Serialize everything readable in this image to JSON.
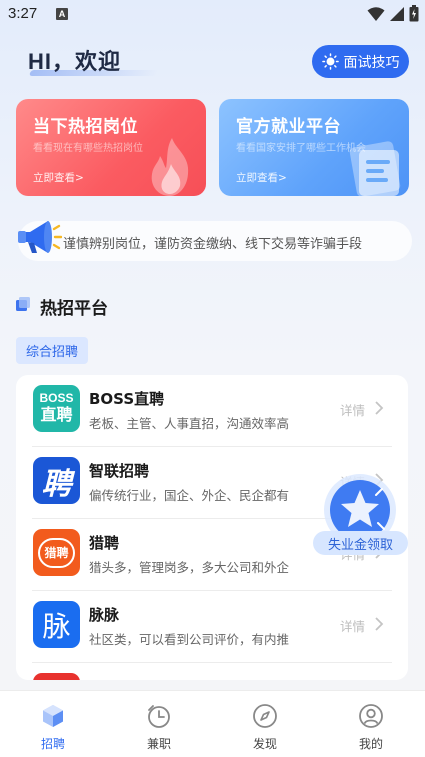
{
  "status_bar": {
    "time": "3:27",
    "notif_letter": "A"
  },
  "header": {
    "greeting": "HI，欢迎",
    "tips_button": "面试技巧"
  },
  "cards": [
    {
      "title": "当下热招岗位",
      "subtitle": "看看现在有哪些热招岗位",
      "link": "立即查看>"
    },
    {
      "title": "官方就业平台",
      "subtitle": "看看国家安排了哪些工作机会",
      "link": "立即查看>"
    }
  ],
  "notice": {
    "text": "谨慎辨别岗位，谨防资金缴纳、线下交易等诈骗手段"
  },
  "section": {
    "title": "热招平台",
    "chip": "综合招聘"
  },
  "platforms": [
    {
      "name": "BOSS直聘",
      "desc": "老板、主管、人事直招，沟通效率高",
      "detail": "详情",
      "logo_text": [
        "BOSS",
        "直聘"
      ],
      "color": "#21b7a8"
    },
    {
      "name": "智联招聘",
      "desc": "偏传统行业，国企、外企、民企都有",
      "detail": "详情",
      "logo_text": [
        "聘"
      ],
      "color": "#1b57d6"
    },
    {
      "name": "猎聘",
      "desc": "猎头多，管理岗多，多大公司和外企",
      "detail": "详情",
      "logo_text": [
        "猎聘"
      ],
      "color": "#f25b1d"
    },
    {
      "name": "脉脉",
      "desc": "社区类，可以看到公司评价，有内推",
      "detail": "详情",
      "logo_text": [
        "脉"
      ],
      "color": "#1a6df0"
    }
  ],
  "float_badge": {
    "label": "失业金领取"
  },
  "bottom_nav": [
    {
      "label": "招聘",
      "icon": "cube-icon",
      "active": true
    },
    {
      "label": "兼职",
      "icon": "clock-icon",
      "active": false
    },
    {
      "label": "发现",
      "icon": "compass-icon",
      "active": false
    },
    {
      "label": "我的",
      "icon": "user-icon",
      "active": false
    }
  ],
  "colors": {
    "accent": "#2f6bf0",
    "hot_card": "#fb5b61",
    "gov_card": "#5fa3fb"
  }
}
